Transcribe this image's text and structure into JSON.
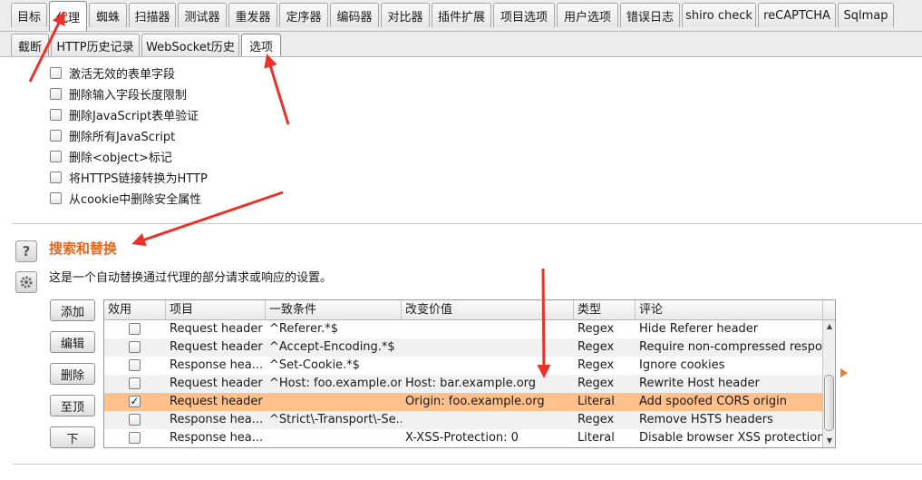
{
  "tabs": [
    "目标",
    "代理",
    "蜘蛛",
    "扫描器",
    "测试器",
    "重发器",
    "定序器",
    "编码器",
    "对比器",
    "插件扩展",
    "项目选项",
    "用户选项",
    "错误日志",
    "shiro check",
    "reCAPTCHA",
    "Sqlmap"
  ],
  "active_tab": "代理",
  "subtabs": [
    "截断",
    "HTTP历史记录",
    "WebSocket历史",
    "选项"
  ],
  "active_subtab": "选项",
  "checkboxes": [
    "激活无效的表单字段",
    "删除输入字段长度限制",
    "删除JavaScript表单验证",
    "删除所有JavaScript",
    "删除<object>标记",
    "将HTTPS链接转换为HTTP",
    "从cookie中删除安全属性"
  ],
  "section": {
    "title": "搜索和替换",
    "description": "这是一个自动替换通过代理的部分请求或响应的设置。",
    "help_icon": "help-icon",
    "settings_icon": "gear-icon"
  },
  "buttons": {
    "add": "添加",
    "edit": "编辑",
    "remove": "删除",
    "up": "至顶",
    "down": "下"
  },
  "table": {
    "columns": [
      "效用",
      "项目",
      "一致条件",
      "改变价值",
      "类型",
      "评论"
    ],
    "rows": [
      {
        "enabled": false,
        "item": "Request header",
        "match": "^Referer.*$",
        "replace": "",
        "type": "Regex",
        "comment": "Hide Referer header"
      },
      {
        "enabled": false,
        "item": "Request header",
        "match": "^Accept-Encoding.*$",
        "replace": "",
        "type": "Regex",
        "comment": "Require non-compressed respo..."
      },
      {
        "enabled": false,
        "item": "Response hea...",
        "match": "^Set-Cookie.*$",
        "replace": "",
        "type": "Regex",
        "comment": "Ignore cookies"
      },
      {
        "enabled": false,
        "item": "Request header",
        "match": "^Host: foo.example.org$",
        "replace": "Host: bar.example.org",
        "type": "Regex",
        "comment": "Rewrite Host header"
      },
      {
        "enabled": true,
        "item": "Request header",
        "match": "",
        "replace": "Origin: foo.example.org",
        "type": "Literal",
        "comment": "Add spoofed CORS origin",
        "selected": true
      },
      {
        "enabled": false,
        "item": "Response hea...",
        "match": "^Strict\\-Transport\\-Se...",
        "replace": "",
        "type": "Regex",
        "comment": "Remove HSTS headers"
      },
      {
        "enabled": false,
        "item": "Response hea...",
        "match": "",
        "replace": "X-XSS-Protection: 0",
        "type": "Literal",
        "comment": "Disable browser XSS protection"
      }
    ]
  },
  "colors": {
    "accent": "#e8641a",
    "selected_row": "#ffc08c",
    "annotation_arrow": "#e8322a"
  }
}
